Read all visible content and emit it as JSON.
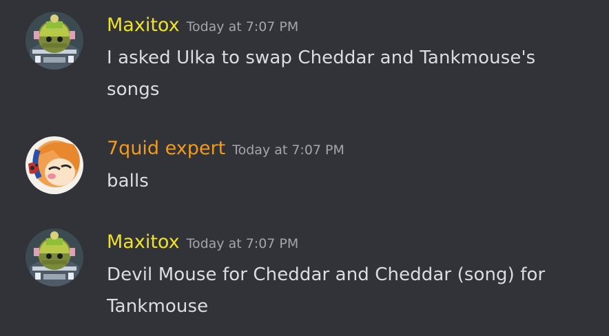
{
  "messages": [
    {
      "author": "Maxitox",
      "timestamp": "Today at 7:07 PM",
      "content": "I asked Ulka to swap Cheddar and Tankmouse's songs",
      "author_color": "#f0e224",
      "avatar": "maxitox-avatar"
    },
    {
      "author": "7quid expert",
      "timestamp": "Today at 7:07 PM",
      "content": "balls",
      "author_color": "#f29b1c",
      "avatar": "squid-expert-avatar"
    },
    {
      "author": "Maxitox",
      "timestamp": "Today at 7:07 PM",
      "content": "Devil Mouse for Cheddar and Cheddar (song) for Tankmouse",
      "author_color": "#f0e224",
      "avatar": "maxitox-avatar"
    }
  ]
}
